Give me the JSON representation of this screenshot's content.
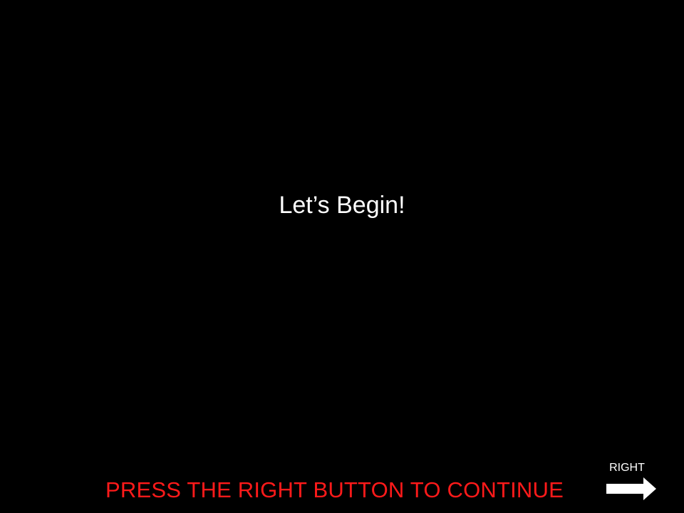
{
  "screen": {
    "headline": "Let’s Begin!",
    "instruction": "PRESS THE RIGHT BUTTON TO CONTINUE",
    "right_hint": {
      "label": "RIGHT",
      "icon": "right-arrow-icon"
    }
  },
  "colors": {
    "background": "#000000",
    "headline": "#ffffff",
    "instruction": "#ff1a1a",
    "hint": "#ffffff"
  }
}
